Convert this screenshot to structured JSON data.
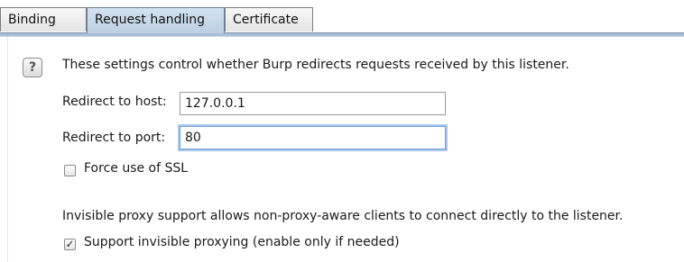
{
  "tabs": [
    {
      "label": "Binding",
      "active": false
    },
    {
      "label": "Request handling",
      "active": true
    },
    {
      "label": "Certificate",
      "active": false
    }
  ],
  "help_icon": "question-mark-icon",
  "description": "These settings control whether Burp redirects requests received by this listener.",
  "redirect_host": {
    "label": "Redirect to host:",
    "value": "127.0.0.1"
  },
  "redirect_port": {
    "label": "Redirect to port:",
    "value": "80"
  },
  "force_ssl": {
    "label": "Force use of SSL",
    "checked": false
  },
  "invisible_description": "Invisible proxy support allows non-proxy-aware clients to connect directly to the listener.",
  "invisible_proxy": {
    "label": "Support invisible proxying (enable only if needed)",
    "checked": true
  },
  "colors": {
    "active_tab": "#c8d8ea",
    "focus_ring": "#a8c8ee"
  }
}
